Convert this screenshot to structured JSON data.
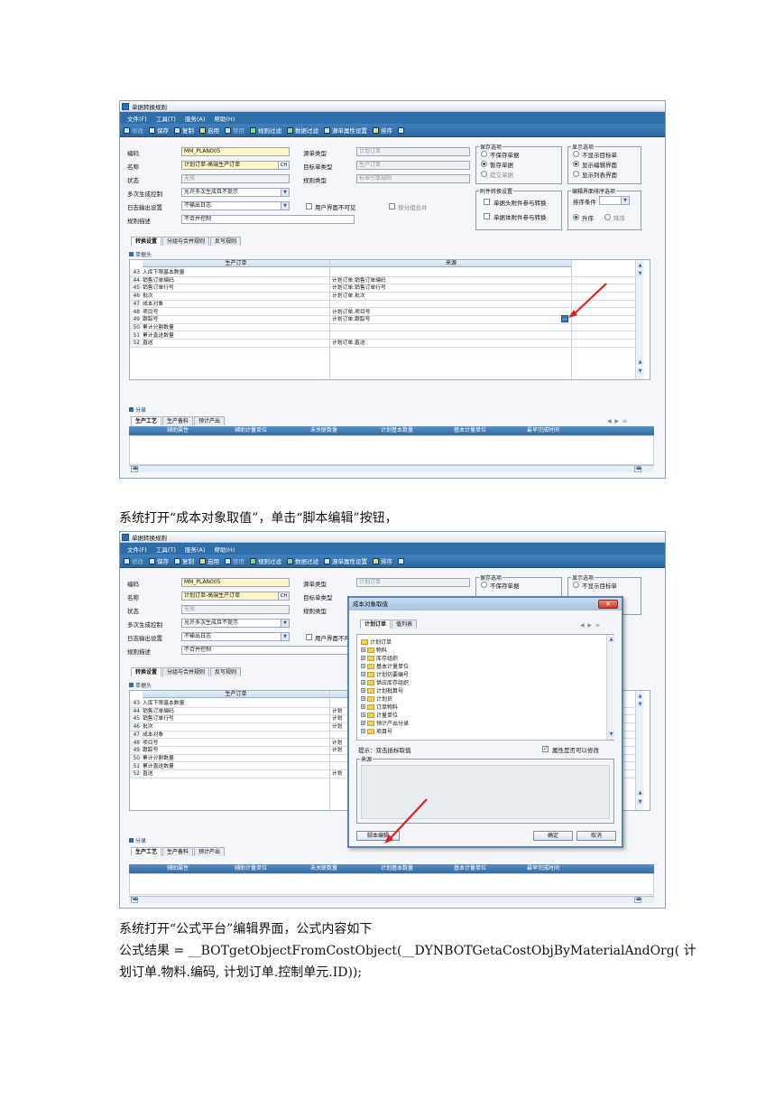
{
  "app": {
    "window_title": "单据转换规则",
    "menu": [
      "文件(F)",
      "工具(T)",
      "服务(A)",
      "帮助(H)"
    ],
    "toolbar": [
      "修改",
      "保存",
      "复制",
      "启用",
      "禁用",
      "规则过滤",
      "数据过滤",
      "源单属性设置",
      "排序"
    ]
  },
  "form": {
    "code_label": "编码",
    "code_value": "MM_PLAN005",
    "name_label": "名称",
    "name_value": "计划订单-高端生产订单",
    "name_lang": "CH",
    "status_label": "状态",
    "status_value": "无效",
    "multi_label": "多次生成控制",
    "multi_value": "允许多次生成且不提示",
    "log_label": "日志输出设置",
    "log_value": "不输出日志",
    "desc_label": "规则描述",
    "desc_value": "不合并控制",
    "src_type_label": "源单类型",
    "src_type_value": "计划订单",
    "tgt_type_label": "目标单类型",
    "tgt_type_value": "生产订单",
    "rule_type_label": "规则类型",
    "rule_type_value": "标准引擎规则",
    "ui_invisible": "用户界面不可见",
    "group_merge": "按分组合并",
    "save_group": "保存选项",
    "save_opts": [
      "不保存单据",
      "暂存单据",
      "提交单据"
    ],
    "show_group": "显示选项",
    "show_opts": [
      "不显示目标单",
      "显示编辑界面",
      "显示列表界面"
    ],
    "attach_group": "附件转换设置",
    "attach_opts": [
      "单据头附件参与转换",
      "单据体附件参与转换"
    ],
    "edit_group": "编辑界面排序选项",
    "sort_cond_label": "排序条件",
    "sort_opts": [
      "升序",
      "降序"
    ]
  },
  "tabs": [
    "转换设置",
    "分组与合并规则",
    "反写规则"
  ],
  "header_section": "单据头",
  "grid": {
    "col_target": "生产订单",
    "col_source": "来源",
    "rows": [
      {
        "n": "43",
        "target": "入库下限基本数量",
        "source": ""
      },
      {
        "n": "44",
        "target": "销售订单编码",
        "source": "计划订单.销售订单编码"
      },
      {
        "n": "45",
        "target": "销售订单行号",
        "source": "计划订单.销售订单行号"
      },
      {
        "n": "46",
        "target": "批次",
        "source": "计划订单.批次"
      },
      {
        "n": "47",
        "target": "成本对象",
        "source": ""
      },
      {
        "n": "48",
        "target": "项目号",
        "source": "计划订单.项目号"
      },
      {
        "n": "49",
        "target": "跟踪号",
        "source": "计划订单.跟踪号"
      },
      {
        "n": "50",
        "target": "累计分割数量",
        "source": ""
      },
      {
        "n": "51",
        "target": "累计直送数量",
        "source": ""
      },
      {
        "n": "52",
        "target": "直送",
        "source": "计划订单.直送"
      }
    ]
  },
  "entry_section": "分录",
  "entry_tabs": [
    "生产工艺",
    "生产备料",
    "预计产出"
  ],
  "entry_cols": [
    "辅助属性",
    "辅助计量单位",
    "未关联数量",
    "计划基本数量",
    "基本计量单位",
    "最早完成时间"
  ],
  "caption1": "系统打开“成本对象取值”，单击“脚本编辑”按钮，",
  "dialog": {
    "title": "成本对象取值",
    "tabs": [
      "计划订单",
      "值列表"
    ],
    "root": "计划订单",
    "nodes": [
      "物料",
      "库存组织",
      "基本计量单位",
      "计划仿要编号",
      "供应库存组织",
      "计划批算号",
      "计划员",
      "订单物料",
      "计量单位",
      "预计产出分录",
      "项目号"
    ],
    "hint": "提示：双击插标取值",
    "editable": "属性是否可以修改",
    "source_label": "来源",
    "script_btn": "脚本编辑",
    "ok_btn": "确定",
    "cancel_btn": "取消"
  },
  "caption2": "系统打开“公式平台”编辑界面，公式内容如下",
  "caption3": "公式结果  =  __BOTgetObjectFromCostObject(__DYNBOTGetaCostObjByMaterialAndOrg( 计",
  "caption4": "划订单.物料.编码, 计划订单.控制单元.ID));",
  "colors": {
    "menubar": "#2f6ea8",
    "toolbar": "#2a669f",
    "arrow": "#e02020"
  }
}
